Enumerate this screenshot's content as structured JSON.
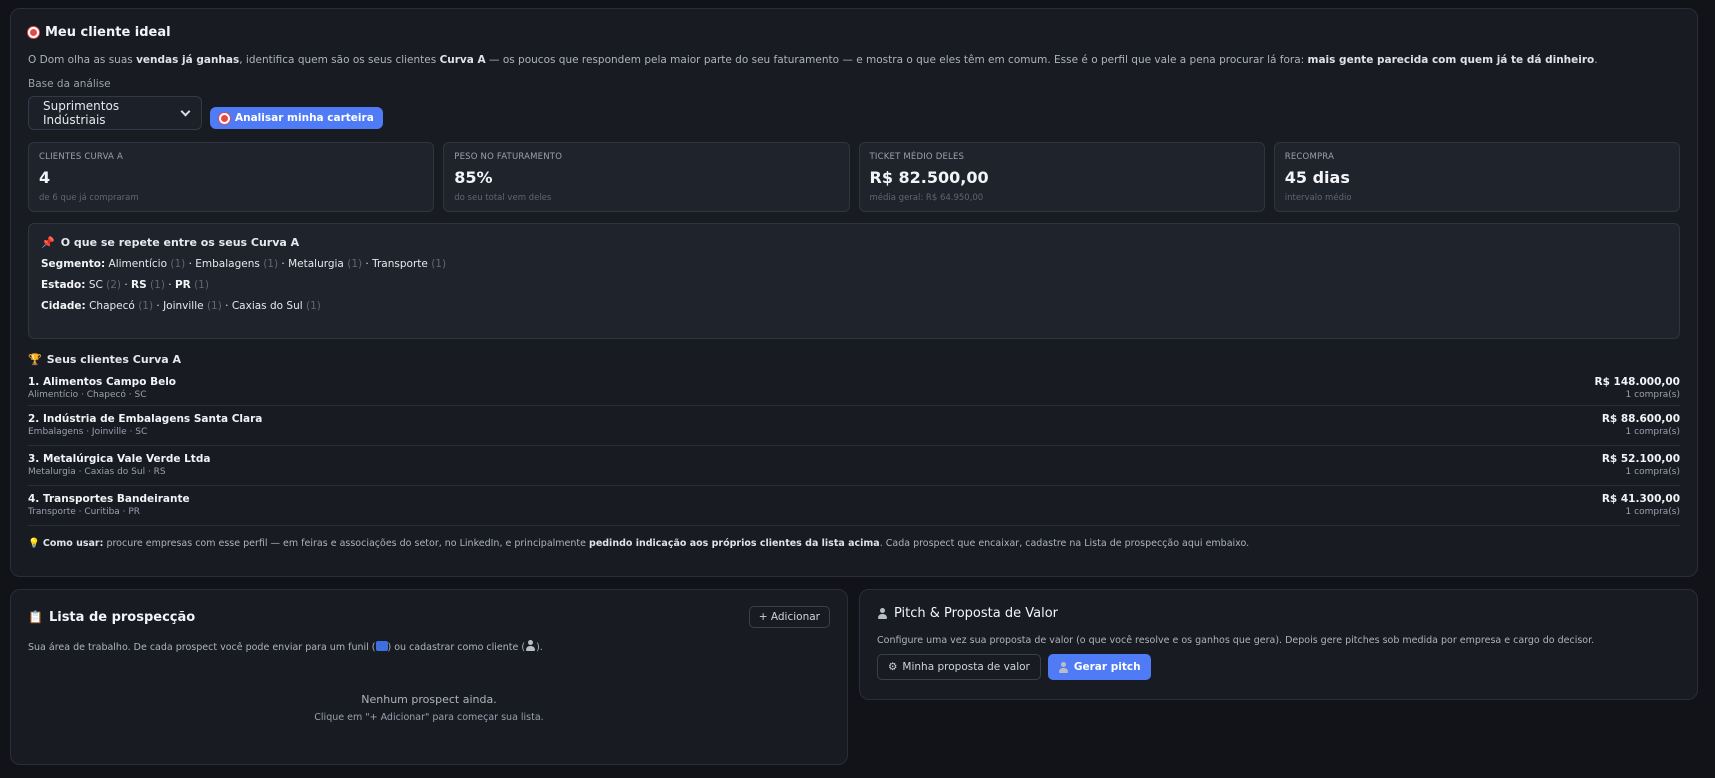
{
  "ideal": {
    "title": "Meu cliente ideal",
    "desc_1": "O Dom olha as suas ",
    "desc_b1": "vendas já ganhas",
    "desc_2": ", identifica quem são os seus clientes ",
    "desc_b2": "Curva A",
    "desc_3": " — os poucos que respondem pela maior parte do seu faturamento — e mostra o que eles têm em comum. Esse é o perfil que vale a pena procurar lá fora: ",
    "desc_b3": "mais gente parecida com quem já te dá dinheiro",
    "desc_4": ".",
    "base_label": "Base da análise",
    "base_value": "Suprimentos Indústriais",
    "analyze_label": "Analisar minha carteira",
    "stats": [
      {
        "label": "Clientes Curva A",
        "value": "4",
        "sub": "de 6 que já compraram"
      },
      {
        "label": "Peso no faturamento",
        "value": "85%",
        "sub": "do seu total vem deles"
      },
      {
        "label": "Ticket médio deles",
        "value": "R$ 82.500,00",
        "sub": "média geral: R$ 64.950,00"
      },
      {
        "label": "Recompra",
        "value": "45 dias",
        "sub": "intervalo médio"
      }
    ],
    "repeat_title": "O que se repete entre os seus Curva A",
    "repeat": {
      "segmento_label": "Segmento:",
      "segmento": [
        {
          "name": "Alimentício",
          "count": "(1)"
        },
        {
          "name": "Embalagens",
          "count": "(1)"
        },
        {
          "name": "Metalurgia",
          "count": "(1)"
        },
        {
          "name": "Transporte",
          "count": "(1)"
        }
      ],
      "estado_label": "Estado:",
      "estado": [
        {
          "name": "SC",
          "count": "(2)"
        },
        {
          "name": "RS",
          "count": "(1)"
        },
        {
          "name": "PR",
          "count": "(1)"
        }
      ],
      "cidade_label": "Cidade:",
      "cidade": [
        {
          "name": "Chapecó",
          "count": "(1)"
        },
        {
          "name": "Joinville",
          "count": "(1)"
        },
        {
          "name": "Caxias do Sul",
          "count": "(1)"
        }
      ]
    },
    "clients_title": "Seus clientes Curva A",
    "clients": [
      {
        "name": "1. Alimentos Campo Belo",
        "meta": "Alimentício · Chapecó · SC",
        "value": "R$ 148.000,00",
        "count": "1 compra(s)"
      },
      {
        "name": "2. Indústria de Embalagens Santa Clara",
        "meta": "Embalagens · Joinville · SC",
        "value": "R$ 88.600,00",
        "count": "1 compra(s)"
      },
      {
        "name": "3. Metalúrgica Vale Verde Ltda",
        "meta": "Metalurgia · Caxias do Sul · RS",
        "value": "R$ 52.100,00",
        "count": "1 compra(s)"
      },
      {
        "name": "4. Transportes Bandeirante",
        "meta": "Transporte · Curitiba · PR",
        "value": "R$ 41.300,00",
        "count": "1 compra(s)"
      }
    ],
    "howto_label": "Como usar:",
    "howto_1": " procure empresas com esse perfil — em feiras e associações do setor, no LinkedIn, e principalmente ",
    "howto_b": "pedindo indicação aos próprios clientes da lista acima",
    "howto_2": ". Cada prospect que encaixar, cadastre na Lista de prospecção aqui embaixo."
  },
  "prospect": {
    "title": "Lista de prospecção",
    "add_label": "+ Adicionar",
    "desc_1": "Sua área de trabalho. De cada prospect você pode enviar para um funil (",
    "desc_2": ") ou cadastrar como cliente (",
    "desc_3": ").",
    "empty_title": "Nenhum prospect ainda.",
    "empty_sub": "Clique em \"+ Adicionar\" para começar sua lista."
  },
  "pitch": {
    "title": "Pitch & Proposta de Valor",
    "desc": "Configure uma vez sua proposta de valor (o que você resolve e os ganhos que gera). Depois gere pitches sob medida por empresa e cargo do decisor.",
    "proposal_label": "Minha proposta de valor",
    "generate_label": "Gerar pitch"
  },
  "colors": {
    "accent": "#4f7cf6",
    "background": "#111318",
    "card": "#181b22"
  }
}
